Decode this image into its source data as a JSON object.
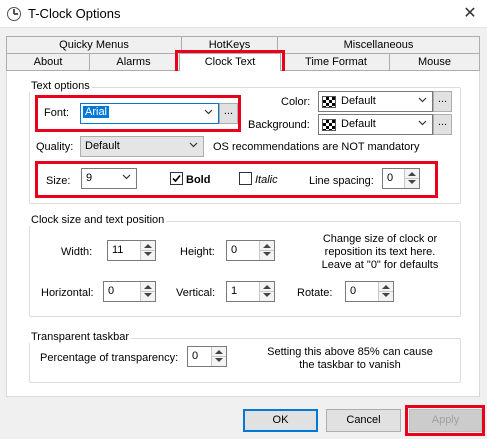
{
  "window": {
    "title": "T-Clock Options",
    "close_icon": "close-icon"
  },
  "tabs": {
    "row_back": [
      "Quicky Menus",
      "HotKeys",
      "Miscellaneous"
    ],
    "row_front": [
      "About",
      "Alarms",
      "Clock Text",
      "Time Format",
      "Mouse"
    ],
    "active": "Clock Text"
  },
  "text_options": {
    "group_label": "Text options",
    "font_label": "Font:",
    "font_value": "Arial",
    "color_label": "Color:",
    "color_value": "Default",
    "background_label": "Background:",
    "background_value": "Default",
    "quality_label": "Quality:",
    "quality_value": "Default",
    "quality_note": "OS recommendations are NOT mandatory",
    "size_label": "Size:",
    "size_value": "9",
    "bold_label": "Bold",
    "bold_checked": true,
    "italic_label": "Italic",
    "italic_checked": false,
    "line_spacing_label": "Line spacing:",
    "line_spacing_value": "0",
    "ellipsis": "..."
  },
  "clock_size": {
    "group_label": "Clock size and text position",
    "width_label": "Width:",
    "width_value": "11",
    "height_label": "Height:",
    "height_value": "0",
    "horizontal_label": "Horizontal:",
    "horizontal_value": "0",
    "vertical_label": "Vertical:",
    "vertical_value": "1",
    "rotate_label": "Rotate:",
    "rotate_value": "0",
    "note_line1": "Change size of clock or",
    "note_line2": "reposition its text here.",
    "note_line3": "Leave at \"0\" for defaults"
  },
  "transparent": {
    "group_label": "Transparent taskbar",
    "percent_label": "Percentage of transparency:",
    "percent_value": "0",
    "note_line1": "Setting this above 85% can cause",
    "note_line2": "the taskbar to vanish"
  },
  "buttons": {
    "ok": "OK",
    "cancel": "Cancel",
    "apply": "Apply"
  },
  "colors": {
    "highlight": "#e8001c",
    "focus": "#0078d7"
  }
}
